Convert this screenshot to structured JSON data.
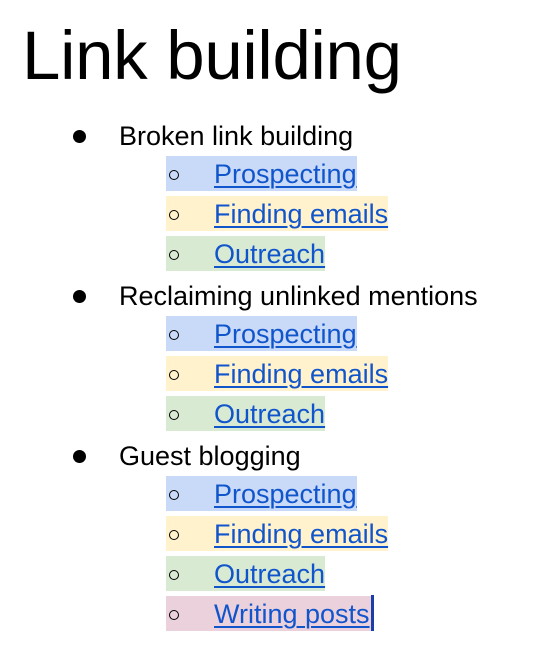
{
  "document": {
    "title": "Link building",
    "sections": [
      {
        "label": "Broken link building",
        "items": [
          {
            "label": "Prospecting",
            "highlight": "#c9daf8"
          },
          {
            "label": "Finding emails",
            "highlight": "#fff2cc"
          },
          {
            "label": "Outreach",
            "highlight": "#d9ead3"
          }
        ]
      },
      {
        "label": "Reclaiming unlinked mentions",
        "items": [
          {
            "label": "Prospecting",
            "highlight": "#c9daf8"
          },
          {
            "label": "Finding emails",
            "highlight": "#fff2cc"
          },
          {
            "label": "Outreach",
            "highlight": "#d9ead3"
          }
        ]
      },
      {
        "label": "Guest blogging",
        "items": [
          {
            "label": "Prospecting",
            "highlight": "#c9daf8"
          },
          {
            "label": "Finding emails",
            "highlight": "#fff2cc"
          },
          {
            "label": "Outreach",
            "highlight": "#d9ead3"
          },
          {
            "label": "Writing posts",
            "highlight": "#ead1dc"
          }
        ]
      }
    ],
    "link_color": "#1155cc",
    "cursor_after": "Writing posts"
  }
}
